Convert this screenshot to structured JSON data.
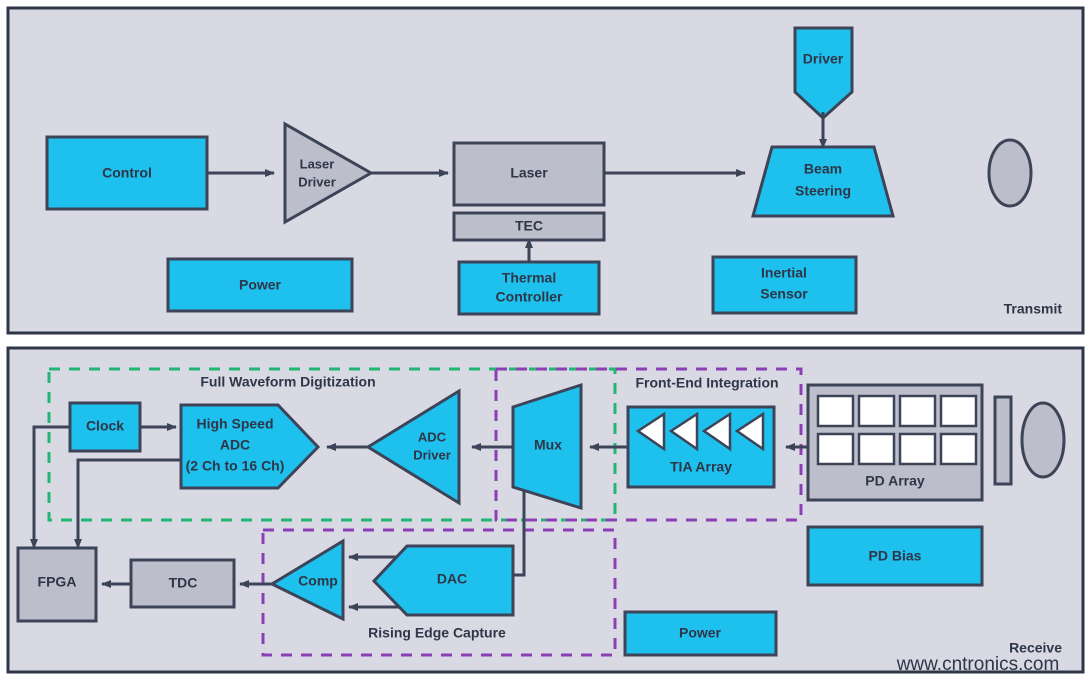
{
  "colors": {
    "panel_fill": "#d8d9e3",
    "panel_stroke": "#2e3648",
    "cyan": "#1ec0ee",
    "gray": "#bcbfcb",
    "white": "#ffffff",
    "stroke": "#3d4458",
    "text": "#2e3648",
    "green_dash": "#22b573",
    "green_label": "#11b57a",
    "purple_dash": "#8b3fb5",
    "purple_label": "#8b3fb5",
    "watermark": "#9ec99a"
  },
  "panels": [
    {
      "id": "transmit",
      "tag": "Transmit"
    },
    {
      "id": "receive",
      "tag": "Receive"
    }
  ],
  "transmit": {
    "blocks": [
      {
        "id": "control",
        "label": "Control",
        "shape": "rect",
        "fill": "cyan"
      },
      {
        "id": "laser-driver",
        "label_lines": [
          "Laser",
          "Driver"
        ],
        "shape": "triangle-right",
        "fill": "gray"
      },
      {
        "id": "laser",
        "label": "Laser",
        "shape": "rect",
        "fill": "gray"
      },
      {
        "id": "tec",
        "label": "TEC",
        "shape": "rect",
        "fill": "gray"
      },
      {
        "id": "thermal-controller",
        "label_lines": [
          "Thermal",
          "Controller"
        ],
        "shape": "rect",
        "fill": "cyan"
      },
      {
        "id": "power",
        "label": "Power",
        "shape": "rect",
        "fill": "cyan"
      },
      {
        "id": "driver",
        "label": "Driver",
        "shape": "pentagon-down",
        "fill": "cyan"
      },
      {
        "id": "beam-steering",
        "label_lines": [
          "Beam",
          "Steering"
        ],
        "shape": "trapezoid",
        "fill": "cyan"
      },
      {
        "id": "inertial-sensor",
        "label_lines": [
          "Inertial",
          "Sensor"
        ],
        "shape": "rect",
        "fill": "cyan"
      },
      {
        "id": "tx-lens",
        "label": "",
        "shape": "ellipse",
        "fill": "gray"
      }
    ]
  },
  "receive": {
    "blocks": [
      {
        "id": "clock",
        "label": "Clock",
        "shape": "rect",
        "fill": "cyan"
      },
      {
        "id": "high-speed-adc",
        "label_lines": [
          "High Speed",
          "ADC",
          "(2 Ch to 16 Ch)"
        ],
        "shape": "pentagon-right",
        "fill": "cyan"
      },
      {
        "id": "adc-driver",
        "label_lines": [
          "ADC",
          "Driver"
        ],
        "shape": "triangle-left",
        "fill": "cyan"
      },
      {
        "id": "mux",
        "label": "Mux",
        "shape": "trapezoid-right",
        "fill": "cyan"
      },
      {
        "id": "tia-array",
        "label": "TIA Array",
        "shape": "rect-with-triangles",
        "fill": "cyan",
        "triangle_count": 4
      },
      {
        "id": "pd-array",
        "label": "PD Array",
        "shape": "rect-with-cells",
        "fill": "gray",
        "cell_rows": 2,
        "cell_cols": 4
      },
      {
        "id": "rx-filter",
        "label": "",
        "shape": "bar",
        "fill": "gray"
      },
      {
        "id": "rx-lens",
        "label": "",
        "shape": "ellipse",
        "fill": "gray"
      },
      {
        "id": "pd-bias",
        "label": "PD Bias",
        "shape": "rect",
        "fill": "cyan"
      },
      {
        "id": "power",
        "label": "Power",
        "shape": "rect",
        "fill": "cyan"
      },
      {
        "id": "fpga",
        "label": "FPGA",
        "shape": "rect",
        "fill": "gray"
      },
      {
        "id": "tdc",
        "label": "TDC",
        "shape": "rect",
        "fill": "gray"
      },
      {
        "id": "comp",
        "label": "Comp",
        "shape": "triangle-left",
        "fill": "cyan"
      },
      {
        "id": "dac",
        "label": "DAC",
        "shape": "pentagon-left",
        "fill": "cyan"
      }
    ],
    "groups": [
      {
        "id": "full-waveform-digitization",
        "label": "Full Waveform Digitization",
        "color": "green"
      },
      {
        "id": "front-end-integration",
        "label": "Front-End Integration",
        "color": "purple"
      },
      {
        "id": "rising-edge-capture",
        "label": "Rising Edge Capture",
        "color": "purple"
      }
    ]
  },
  "watermark": {
    "text": "www.cntronics.com"
  }
}
